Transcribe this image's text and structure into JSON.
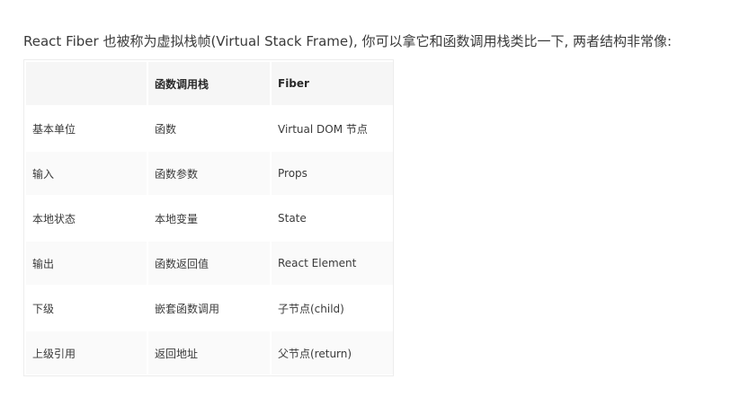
{
  "intro_text": "React Fiber 也被称为虚拟栈帧(Virtual Stack Frame), 你可以拿它和函数调用栈类比一下, 两者结构非常像:",
  "table": {
    "headers": [
      "",
      "函数调用栈",
      "Fiber"
    ],
    "rows": [
      [
        "基本单位",
        "函数",
        "Virtual DOM 节点"
      ],
      [
        "输入",
        "函数参数",
        "Props"
      ],
      [
        "本地状态",
        "本地变量",
        "State"
      ],
      [
        "输出",
        "函数返回值",
        "React Element"
      ],
      [
        "下级",
        "嵌套函数调用",
        "子节点(child)"
      ],
      [
        "上级引用",
        "返回地址",
        "父节点(return)"
      ]
    ]
  }
}
